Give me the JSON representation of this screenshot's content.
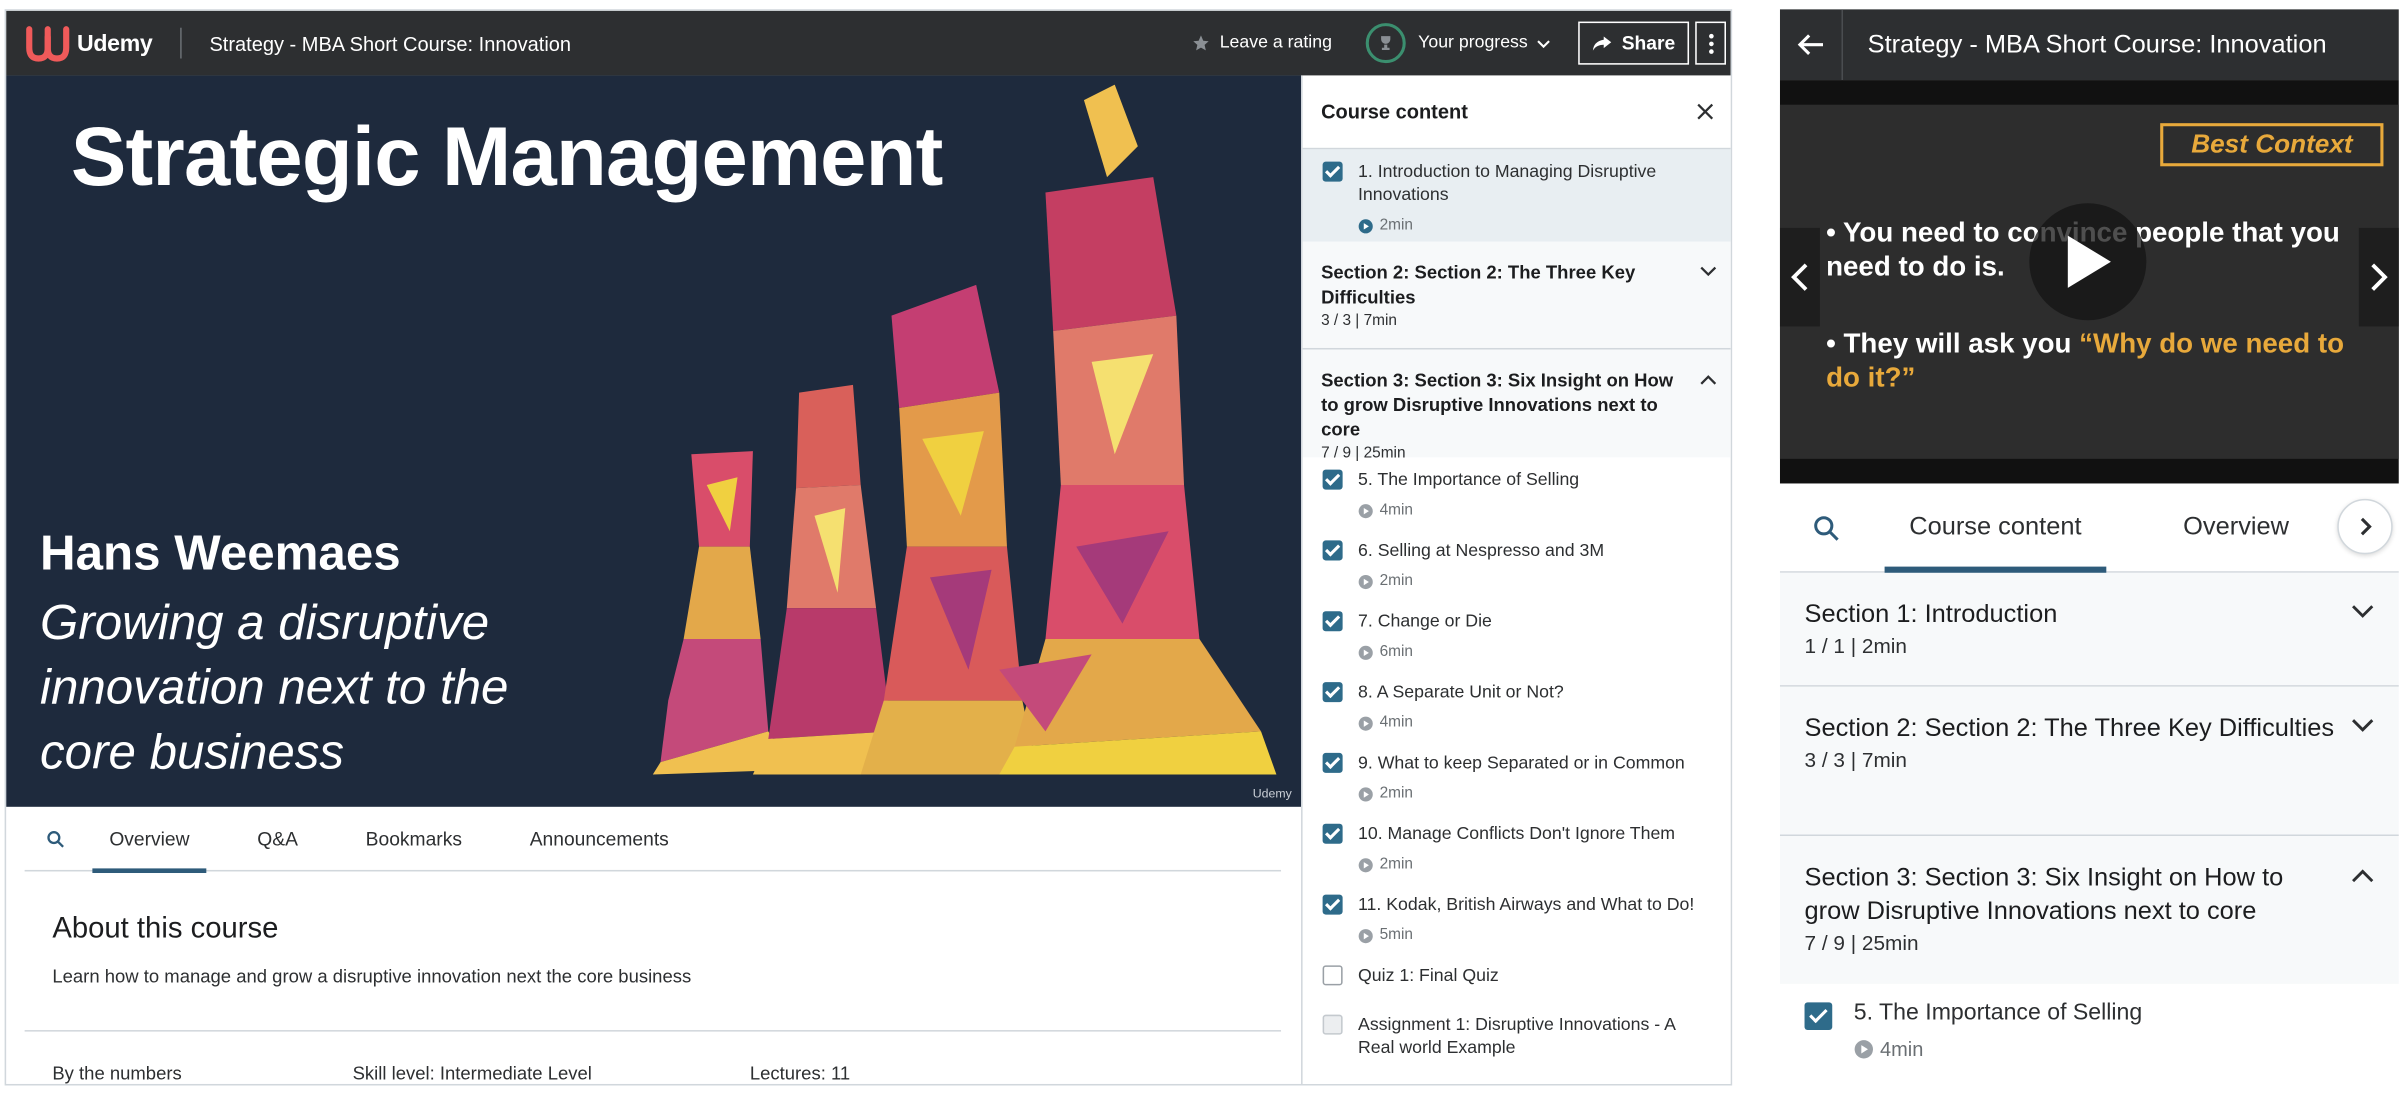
{
  "header": {
    "brand": "Udemy",
    "course_title": "Strategy - MBA Short Course: Innovation",
    "rating_label": "Leave a rating",
    "progress_label": "Your progress",
    "share_label": "Share"
  },
  "video": {
    "title": "Strategic Management",
    "presenter": "Hans Weemaes",
    "subtitle": "Growing a disruptive innovation next to the core business",
    "watermark": "Udemy"
  },
  "tabs": [
    "Overview",
    "Q&A",
    "Bookmarks",
    "Announcements"
  ],
  "about": {
    "heading": "About this course",
    "description": "Learn how to manage and grow a disruptive innovation next the core business"
  },
  "numbers": {
    "label": "By the numbers",
    "skill": "Skill level: Intermediate Level",
    "lectures": "Lectures: 11"
  },
  "sidebar": {
    "heading": "Course content",
    "current_lesson": {
      "title": "1. Introduction to Managing Disruptive Innovations",
      "duration": "2min"
    },
    "section2": {
      "title": "Section 2: Section 2: The Three Key Difficulties",
      "meta": "3 / 3 | 7min"
    },
    "section3": {
      "title": "Section 3: Section 3: Six Insight on How to grow Disruptive Innovations next to core",
      "meta": "7 / 9 | 25min"
    },
    "lessons": [
      {
        "title": "5. The Importance of Selling",
        "duration": "4min"
      },
      {
        "title": "6. Selling at Nespresso and 3M",
        "duration": "2min"
      },
      {
        "title": "7. Change or Die",
        "duration": "6min"
      },
      {
        "title": "8. A Separate Unit or Not?",
        "duration": "4min"
      },
      {
        "title": "9. What to keep Separated or in Common",
        "duration": "2min"
      },
      {
        "title": "10. Manage Conflicts Don't Ignore Them",
        "duration": "2min"
      },
      {
        "title": "11. Kodak, British Airways and What to Do!",
        "duration": "5min"
      }
    ],
    "quiz": "Quiz 1: Final Quiz",
    "assignment": "Assignment 1: Disruptive Innovations - A Real world Example"
  },
  "mobile": {
    "title": "Strategy - MBA Short Course: Innovation",
    "badge": "Best Context",
    "bullet1": "You need to convince people that you need to do is.",
    "bullet2_a": "They will ask you ",
    "bullet2_b": "“Why do we need to do it?”",
    "tab_content": "Course content",
    "tab_overview": "Overview",
    "section1": {
      "title": "Section 1: Introduction",
      "meta": "1 / 1 | 2min"
    },
    "section2": {
      "title": "Section 2: Section 2: The Three Key Difficulties",
      "meta": "3 / 3 | 7min"
    },
    "section3": {
      "title": "Section 3: Section 3: Six Insight on How to grow Disruptive Innovations next to core",
      "meta": "7 / 9 | 25min"
    },
    "lesson": {
      "title": "5. The Importance of Selling",
      "duration": "4min"
    }
  },
  "colors": {
    "topbar": "#2d2f31",
    "accent": "#2e5b7a",
    "checkbox": "#2e6b8a",
    "brand": "#a435f0"
  }
}
